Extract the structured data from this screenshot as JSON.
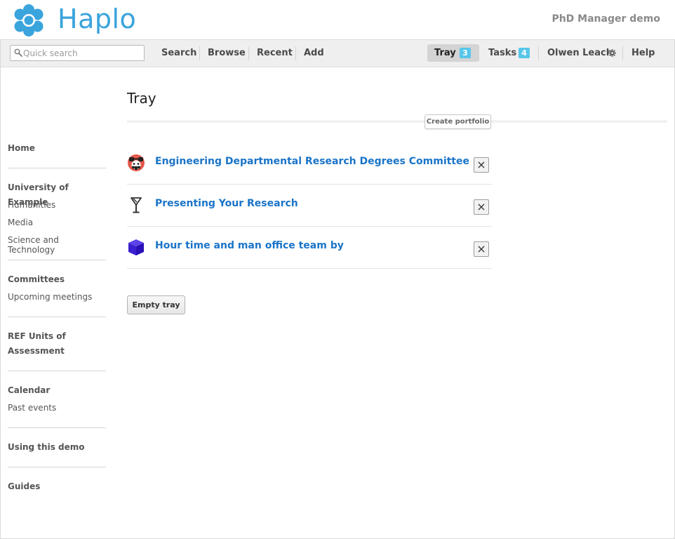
{
  "header": {
    "app_name": "Haplo",
    "app_label": "PhD Manager demo",
    "brand_color": "#3aa4dc"
  },
  "navbar": {
    "search_placeholder": "Quick search",
    "items": [
      {
        "label": "Search"
      },
      {
        "label": "Browse"
      },
      {
        "label": "Recent"
      },
      {
        "label": "Add"
      }
    ],
    "tray": {
      "label": "Tray",
      "count": "3"
    },
    "tasks": {
      "label": "Tasks",
      "count": "4"
    },
    "user": {
      "label": "Olwen Leach"
    },
    "help": {
      "label": "Help"
    },
    "badge_color": "#57c6ea"
  },
  "sidebar": {
    "home": "Home",
    "university": "University of Example",
    "university_items": [
      "Humanities",
      "Media",
      "Science and Technology"
    ],
    "committees": "Committees",
    "committees_items": [
      "Upcoming meetings"
    ],
    "ref_units_line1": "REF Units of",
    "ref_units_line2": "Assessment",
    "calendar": "Calendar",
    "calendar_items": [
      "Past events"
    ],
    "using_demo": "Using this demo",
    "guides": "Guides"
  },
  "main": {
    "title": "Tray",
    "create_portfolio": "Create portfolio",
    "items": [
      {
        "title": "Engineering Departmental Research Degrees Committee",
        "icon": "committee-icon",
        "remove": "×"
      },
      {
        "title": "Presenting Your Research",
        "icon": "event-icon",
        "remove": "×"
      },
      {
        "title": "Hour time and man office team by",
        "icon": "cube-icon",
        "remove": "×"
      }
    ],
    "empty_tray": "Empty tray",
    "link_color": "#1a74c8"
  }
}
